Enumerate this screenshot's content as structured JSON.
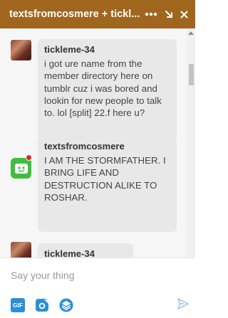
{
  "header": {
    "title": "textsfromcosmere + tickl...",
    "more_icon": "ellipsis-icon",
    "minimize_icon": "arrow-down-right-icon",
    "close_icon": "close-icon"
  },
  "messages": [
    {
      "sender": "tickleme-34",
      "text": "i got ure name from the member directory here on tumblr cuz i was bored and lookin for new people to talk to. lol [split] 22.f here u?"
    },
    {
      "sender": "textsfromcosmere",
      "text": "I AM THE STORMFATHER. I BRING LIFE AND DESTRUCTION ALIKE TO ROSHAR."
    },
    {
      "sender": "tickleme-34",
      "text": ""
    }
  ],
  "composer": {
    "placeholder": "Say your thing",
    "gif_label": "GIF",
    "tools": [
      "gif-icon",
      "camera-icon",
      "stack-icon"
    ],
    "send_icon": "send-icon"
  },
  "colors": {
    "header_bg": "#a0661e",
    "bubble_bg": "#e8e8e8",
    "accent_blue": "#2c8fd6"
  }
}
